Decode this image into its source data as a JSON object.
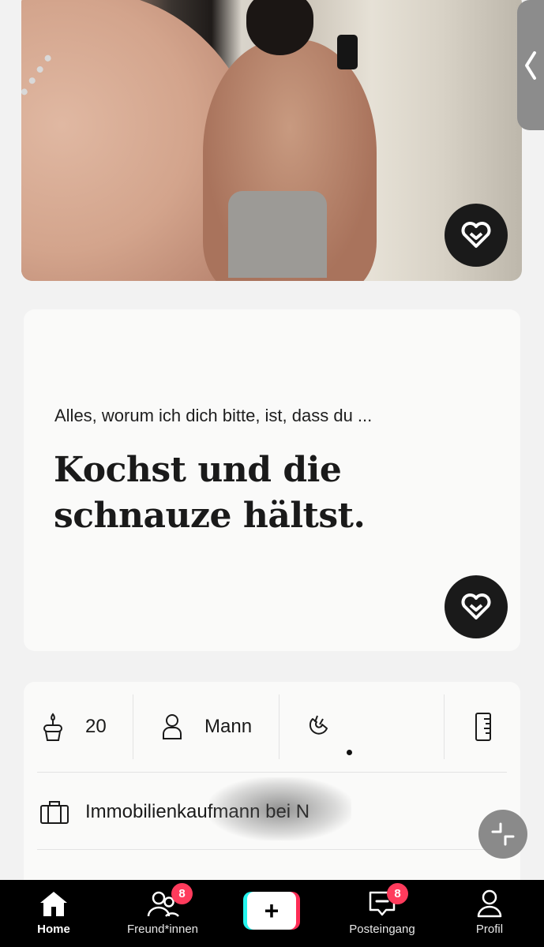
{
  "prompt": {
    "question": "Alles, worum ich dich bitte, ist, dass du ...",
    "answer": "Kochst und die schnauze hältst."
  },
  "info": {
    "age": "20",
    "gender": "Mann",
    "job": "Immobilienkaufmann bei N"
  },
  "icons": {
    "age": "birthday-cake-icon",
    "gender": "person-icon",
    "magnet": "magnet-icon",
    "height": "ruler-icon",
    "job": "briefcase-icon",
    "like": "heart-icon"
  },
  "tabs": [
    {
      "label": "Home",
      "icon": "home-icon",
      "active": true
    },
    {
      "label": "Freund*innen",
      "icon": "friends-icon",
      "badge": "8"
    },
    {
      "label": "+",
      "icon": "plus-icon"
    },
    {
      "label": "Posteingang",
      "icon": "inbox-icon",
      "badge": "8"
    },
    {
      "label": "Profil",
      "icon": "profile-icon"
    }
  ],
  "colors": {
    "background": "#f2f2f2",
    "card": "#fafaf9",
    "tabbar": "#000000",
    "badge": "#ff3b5c",
    "accent_cyan": "#25f4ee",
    "accent_red": "#fe2c55"
  }
}
